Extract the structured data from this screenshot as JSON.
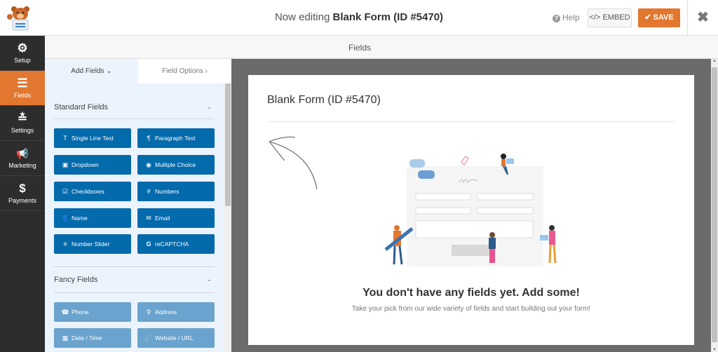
{
  "header": {
    "title_prefix": "Now editing",
    "form_name": "Blank Form (ID #5470)",
    "help_label": "Help",
    "embed_label": "</> EMBED",
    "save_label": "✔ SAVE",
    "close_glyph": "✖"
  },
  "sidebar": {
    "items": [
      {
        "label": "Setup",
        "icon": "⚙"
      },
      {
        "label": "Fields",
        "icon": "☰"
      },
      {
        "label": "Settings",
        "icon": "≛"
      },
      {
        "label": "Marketing",
        "icon": "📢"
      },
      {
        "label": "Payments",
        "icon": "$"
      }
    ]
  },
  "subbar": {
    "label": "Fields"
  },
  "panel": {
    "tabs": [
      {
        "label": "Add Fields ⌄"
      },
      {
        "label": "Field Options ›"
      }
    ],
    "standard_title": "Standard Fields",
    "standard_fields": [
      {
        "label": "Single Line Text",
        "icon": "T"
      },
      {
        "label": "Paragraph Text",
        "icon": "¶"
      },
      {
        "label": "Dropdown",
        "icon": "▣"
      },
      {
        "label": "Multiple Choice",
        "icon": "◉"
      },
      {
        "label": "Checkboxes",
        "icon": "☑"
      },
      {
        "label": "Numbers",
        "icon": "#"
      },
      {
        "label": "Name",
        "icon": "👤"
      },
      {
        "label": "Email",
        "icon": "✉"
      },
      {
        "label": "Number Slider",
        "icon": "≡"
      },
      {
        "label": "reCAPTCHA",
        "icon": "G"
      }
    ],
    "fancy_title": "Fancy Fields",
    "fancy_fields": [
      {
        "label": "Phone",
        "icon": "☎"
      },
      {
        "label": "Address",
        "icon": "⚲"
      },
      {
        "label": "Date / Time",
        "icon": "▦"
      },
      {
        "label": "Website / URL",
        "icon": "🔗"
      }
    ],
    "chevron": "⌄"
  },
  "form": {
    "title": "Blank Form (ID #5470)",
    "empty_heading": "You don't have any fields yet. Add some!",
    "empty_text": "Take your pick from our wide variety of fields and start building out your form!"
  },
  "colors": {
    "accent": "#e27730",
    "field_button": "#036aab",
    "fancy_button": "#6aa3cd",
    "sidebar_bg": "#2d2d2d"
  }
}
